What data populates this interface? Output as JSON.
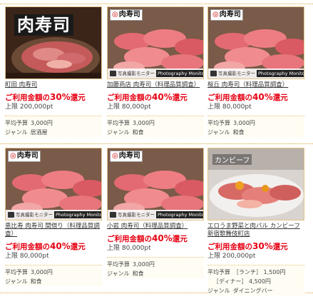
{
  "cards": [
    {
      "image_text": "肉寿司",
      "name": "町田 肉寿司",
      "rate_prefix": "ご利用金額の",
      "rate_value": "30%",
      "rate_suffix": "還元",
      "limit_label": "上限",
      "limit_value": "200,000pt",
      "budget_label": "平均予算",
      "budget_value": "3,000円",
      "genre_label": "ジャンル",
      "genre_value": "居酒屋"
    },
    {
      "logo_text": "肉寿司",
      "monitor_text": "写真撮影モニター",
      "monitor_badge": "Photography Monitor",
      "name": "加藤商店 肉寿司（料理品質調査）",
      "rate_prefix": "ご利用金額の",
      "rate_value": "40%",
      "rate_suffix": "還元",
      "limit_label": "上限",
      "limit_value": "80,000pt",
      "budget_label": "平均予算",
      "budget_value": "3,000円",
      "genre_label": "ジャンル",
      "genre_value": "和食"
    },
    {
      "logo_text": "肉寿司",
      "monitor_text": "写真撮影モニター",
      "monitor_badge": "Photography Monitor",
      "name": "桜丘 肉寿司（料理品質調査）",
      "rate_prefix": "ご利用金額の",
      "rate_value": "40%",
      "rate_suffix": "還元",
      "limit_label": "上限",
      "limit_value": "80,000pt",
      "budget_label": "平均予算",
      "budget_value": "3,000円",
      "genre_label": "ジャンル",
      "genre_value": "和食"
    },
    {
      "logo_text": "肉寿司",
      "monitor_text": "写真撮影モニター",
      "monitor_badge": "Photography Monitor",
      "name": "恵比寿 肉寿司 間借り（料理品質調査）",
      "rate_prefix": "ご利用金額の",
      "rate_value": "40%",
      "rate_suffix": "還元",
      "limit_label": "上限",
      "limit_value": "80,000pt",
      "budget_label": "平均予算",
      "budget_value": "3,000円",
      "genre_label": "ジャンル",
      "genre_value": "和食"
    },
    {
      "logo_text": "肉寿司",
      "monitor_text": "写真撮影モニター",
      "monitor_badge": "Photography Monitor",
      "name": "小岩 肉寿司（料理品質調査）",
      "rate_prefix": "ご利用金額の",
      "rate_value": "40%",
      "rate_suffix": "還元",
      "limit_label": "上限",
      "limit_value": "80,000pt",
      "budget_label": "平均予算",
      "budget_value": "3,000円",
      "genre_label": "ジャンル",
      "genre_value": "和食"
    },
    {
      "image_text": "カンビーフ",
      "name": "エロうま野菜と肉バル カンビーフ 新宿歌舞伎町店",
      "rate_prefix": "ご利用金額の",
      "rate_value": "30%",
      "rate_suffix": "還元",
      "limit_label": "上限",
      "limit_value": "200,000pt",
      "budget_label": "平均予算",
      "budget_lunch_label": "［ランチ］",
      "budget_lunch_value": "1,500円",
      "budget_dinner_label": "［ディナー］",
      "budget_dinner_value": "4,500円",
      "genre_label": "ジャンル",
      "genre_value": "ダイニングバー"
    }
  ]
}
